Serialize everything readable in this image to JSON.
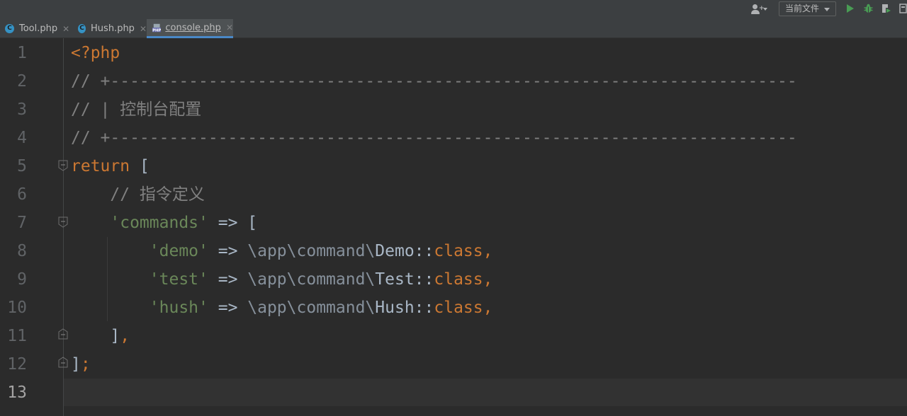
{
  "toolbar": {
    "user_icon": "user-plus-icon",
    "run_config": "当前文件",
    "icons": [
      "run-icon",
      "debug-icon",
      "coverage-icon",
      "more-icon"
    ],
    "accent_green": "#499c54",
    "accent_debug": "#6abf69"
  },
  "tabs": [
    {
      "label": "Tool.php",
      "icon": "php-class-icon",
      "active": false
    },
    {
      "label": "Hush.php",
      "icon": "php-class-icon",
      "active": false
    },
    {
      "label": "console.php",
      "icon": "php-file-icon",
      "active": true
    }
  ],
  "editor": {
    "current_line": 13,
    "lines": [
      {
        "n": "1",
        "tokens": [
          {
            "t": "kw",
            "v": "<?php"
          }
        ]
      },
      {
        "n": "2",
        "tokens": [
          {
            "t": "cm",
            "v": "// +----------------------------------------------------------------------"
          }
        ]
      },
      {
        "n": "3",
        "tokens": [
          {
            "t": "cm",
            "v": "// | 控制台配置"
          }
        ]
      },
      {
        "n": "4",
        "tokens": [
          {
            "t": "cm",
            "v": "// +----------------------------------------------------------------------"
          }
        ]
      },
      {
        "n": "5",
        "tokens": [
          {
            "t": "kw",
            "v": "return"
          },
          {
            "t": "pl",
            "v": " ["
          }
        ]
      },
      {
        "n": "6",
        "tokens": [
          {
            "t": "pl",
            "v": "    "
          },
          {
            "t": "cm",
            "v": "// 指令定义"
          }
        ]
      },
      {
        "n": "7",
        "tokens": [
          {
            "t": "pl",
            "v": "    "
          },
          {
            "t": "st",
            "v": "'commands'"
          },
          {
            "t": "pl",
            "v": " => ["
          }
        ]
      },
      {
        "n": "8",
        "tokens": [
          {
            "t": "pl",
            "v": "        "
          },
          {
            "t": "st",
            "v": "'demo'"
          },
          {
            "t": "pl",
            "v": " => "
          },
          {
            "t": "ns",
            "v": "\\app\\command\\"
          },
          {
            "t": "cl",
            "v": "Demo"
          },
          {
            "t": "pl",
            "v": "::"
          },
          {
            "t": "kw",
            "v": "class,"
          }
        ]
      },
      {
        "n": "9",
        "tokens": [
          {
            "t": "pl",
            "v": "        "
          },
          {
            "t": "st",
            "v": "'test'"
          },
          {
            "t": "pl",
            "v": " => "
          },
          {
            "t": "ns",
            "v": "\\app\\command\\"
          },
          {
            "t": "cl",
            "v": "Test"
          },
          {
            "t": "pl",
            "v": "::"
          },
          {
            "t": "kw",
            "v": "class,"
          }
        ]
      },
      {
        "n": "10",
        "tokens": [
          {
            "t": "pl",
            "v": "        "
          },
          {
            "t": "st",
            "v": "'hush'"
          },
          {
            "t": "pl",
            "v": " => "
          },
          {
            "t": "ns",
            "v": "\\app\\command\\"
          },
          {
            "t": "cl",
            "v": "Hush"
          },
          {
            "t": "pl",
            "v": "::"
          },
          {
            "t": "kw",
            "v": "class,"
          }
        ]
      },
      {
        "n": "11",
        "tokens": [
          {
            "t": "pl",
            "v": "    ]"
          },
          {
            "t": "kw",
            "v": ","
          }
        ]
      },
      {
        "n": "12",
        "tokens": [
          {
            "t": "pl",
            "v": "]"
          },
          {
            "t": "kw",
            "v": ";"
          }
        ]
      },
      {
        "n": "13",
        "tokens": []
      }
    ]
  }
}
